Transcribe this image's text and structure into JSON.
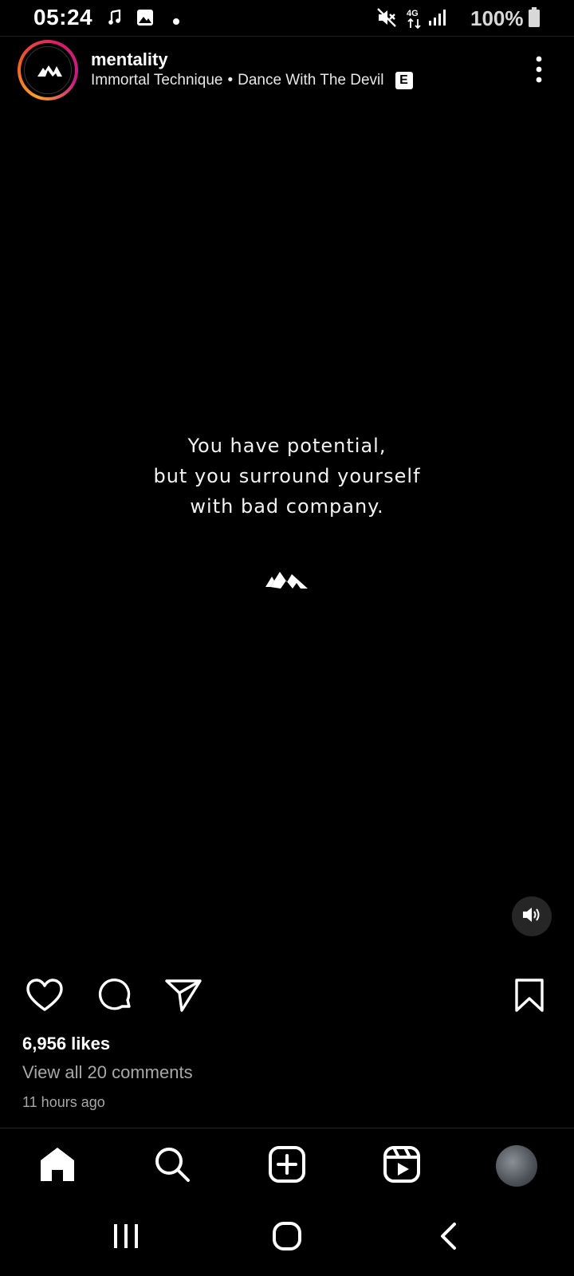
{
  "status_bar": {
    "time": "05:24",
    "network": "4G",
    "battery": "100%"
  },
  "post": {
    "username": "mentality",
    "artist": "Immortal Technique",
    "separator": "•",
    "song_title": "Dance With The Devil",
    "explicit_label": "E",
    "quote_lines": [
      "You have potential,",
      "but you surround yourself",
      "with bad company."
    ],
    "likes": "6,956 likes",
    "comments_link": "View all 20 comments",
    "time_ago": "11 hours ago"
  },
  "icons": {
    "status_left": [
      "music-note-icon",
      "gallery-icon",
      "dot-icon"
    ],
    "status_right": [
      "mute-icon",
      "network-4g-icon",
      "signal-icon",
      "battery-icon"
    ],
    "post_actions": [
      "heart-icon",
      "comment-icon",
      "share-icon",
      "bookmark-icon"
    ],
    "bottom_nav": [
      "home-icon",
      "search-icon",
      "create-icon",
      "reels-icon",
      "profile-avatar"
    ],
    "system_nav": [
      "recents-icon",
      "home-circle-icon",
      "back-icon"
    ]
  }
}
